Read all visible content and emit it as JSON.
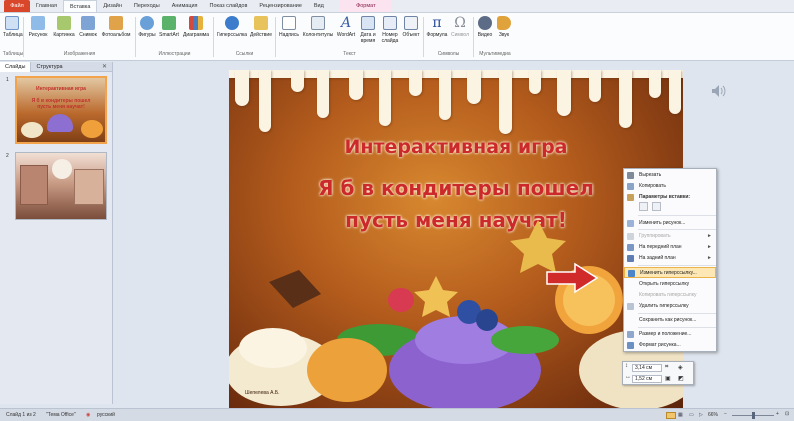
{
  "tabs": [
    "Файл",
    "Главная",
    "Вставка",
    "Дизайн",
    "Переходы",
    "Анимация",
    "Показ слайдов",
    "Рецензирование",
    "Вид",
    "Формат"
  ],
  "ribbon": {
    "buttons": [
      "Таблица",
      "Рисунок",
      "Картинка",
      "Снимок",
      "Фотоальбом",
      "Фигуры",
      "SmartArt",
      "Диаграмма",
      "Гиперссылка",
      "Действие",
      "Надпись",
      "Колонтитулы",
      "WordArt",
      "Дата и время",
      "Номер слайда",
      "Объект",
      "Формула",
      "Символ",
      "Видео",
      "Звук"
    ],
    "groups": [
      "Таблицы",
      "Изображения",
      "Иллюстрации",
      "Ссылки",
      "Текст",
      "Символы",
      "Мультимедиа"
    ]
  },
  "panel": {
    "tabs": [
      "Слайды",
      "Структура"
    ],
    "close_glyph": "✕"
  },
  "slide_thumbs": [
    {
      "num": "1",
      "lines": [
        "Интерактивная игра",
        "Я б в кондитеры пошел",
        "пусть меня научат!"
      ]
    },
    {
      "num": "2"
    }
  ],
  "slide": {
    "line1": "Интерактивная игра",
    "line2": "Я б в кондитеры пошел",
    "line3": "пусть меня научат!",
    "author": "Шепелева А.Б."
  },
  "context_menu": {
    "items": [
      "Вырезать",
      "Копировать",
      "Параметры вставки:",
      "Изменить рисунок...",
      "Группировать",
      "На передний план",
      "На задний план",
      "Изменить гиперссылку...",
      "Открыть гиперссылку",
      "Копировать гиперссылку",
      "Удалить гиперссылку",
      "Сохранить как рисунок...",
      "Размер и положение...",
      "Формат рисунка..."
    ],
    "hover_index": 7,
    "disabled_indices": [
      4,
      9
    ]
  },
  "mini_toolbar": {
    "height": "3,14 см",
    "width": "1,52 см"
  },
  "status": {
    "slide": "Слайд 1 из 2",
    "theme": "\"Тема Office\"",
    "language": "русский",
    "zoom": "66%"
  },
  "colors": {
    "accent": "#d9472b",
    "title": "#cc2a2a",
    "hover": "#fde7b5"
  },
  "icons": [
    "speaker-icon",
    "pi-icon",
    "omega-icon",
    "scissors-icon",
    "copy-icon",
    "paste-icon",
    "link-icon",
    "arrow-icon"
  ]
}
